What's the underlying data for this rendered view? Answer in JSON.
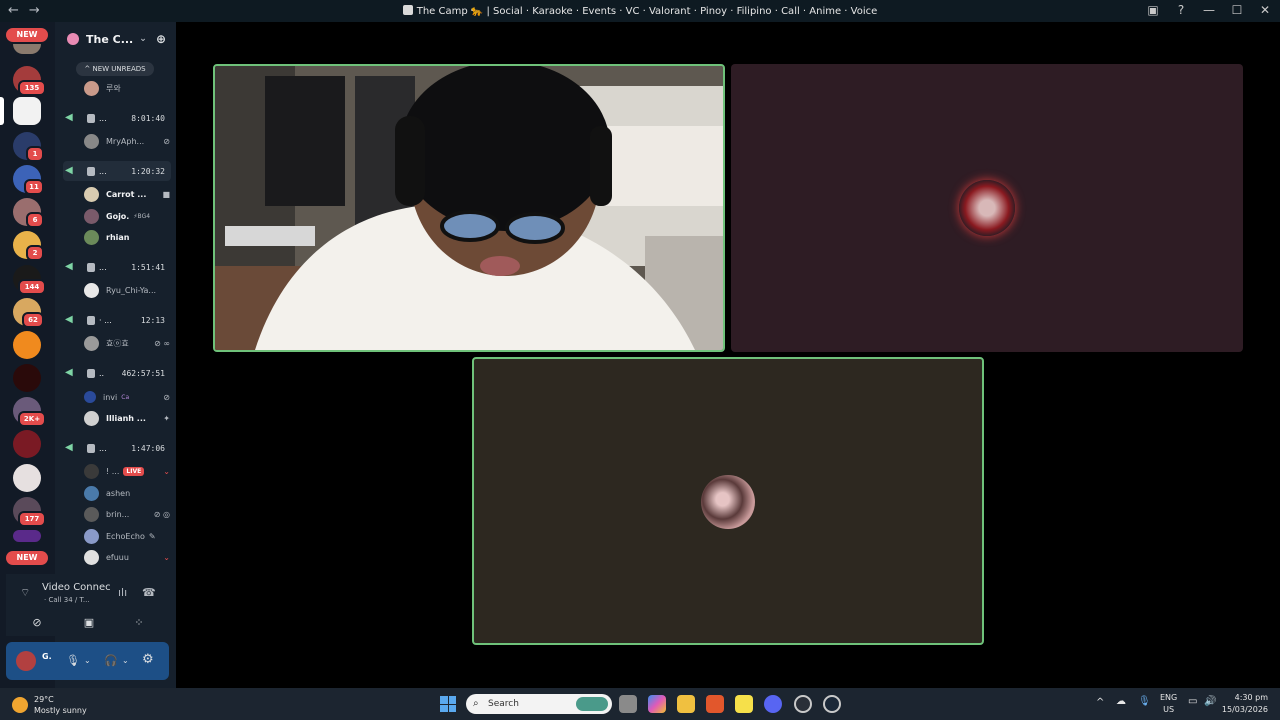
{
  "titlebar": {
    "back": "←",
    "forward": "→",
    "title": "The Camp 🐆 | Social · Karaoke · Events · VC · Valorant · Pinoy · Filipino · Call · Anime · Voice",
    "inbox_icon": "inbox-icon",
    "help": "?",
    "minimize": "—",
    "maximize": "☐",
    "close": "✕"
  },
  "servers": {
    "new_top": "NEW",
    "new_bottom": "NEW",
    "badges": [
      "135",
      "1",
      "11",
      "6",
      "2",
      "144",
      "62",
      "2K+",
      "177"
    ]
  },
  "guild": {
    "name": "The C...",
    "chevron": "⌄",
    "add_member": "👤+",
    "new_unreads": "^ NEW UNREADS"
  },
  "voice_channels": [
    {
      "dots": "...",
      "timer": "8:01:40"
    },
    {
      "dots": "...",
      "timer": "1:20:32"
    },
    {
      "dots": "...",
      "timer": "1:51:41"
    },
    {
      "dots": "· ...",
      "timer": "12:13"
    },
    {
      "dots": "..",
      "timer": "462:57:51"
    },
    {
      "dots": "...",
      "timer": "1:47:06"
    }
  ],
  "users": {
    "u0": "루와",
    "u1": "MryAph...",
    "u2": "Carrot ...",
    "u3": "Gojo.",
    "u3b": "⚡BG4",
    "u4": "rhian",
    "u5": "Ryu_Chi-Ya...",
    "u6": "효ⓞ효",
    "u7": "invi",
    "u7b": "Ca",
    "u8": "Illianh ...",
    "u9": "! ...",
    "live": "LIVE",
    "u10": "ashen",
    "u11": "brin...",
    "u12": "EchoEcho",
    "u13": "efuuu"
  },
  "voice_panel": {
    "title": "Video Connec",
    "subtitle": "· Call 34 / T..."
  },
  "user_panel": {
    "name": "G."
  },
  "taskbar": {
    "temp": "29°C",
    "condition": "Mostly sunny",
    "search": "Search",
    "lang1": "ENG",
    "lang2": "US",
    "time": "4:30 pm",
    "date": "15/03/2026",
    "tray_chevron": "^"
  }
}
